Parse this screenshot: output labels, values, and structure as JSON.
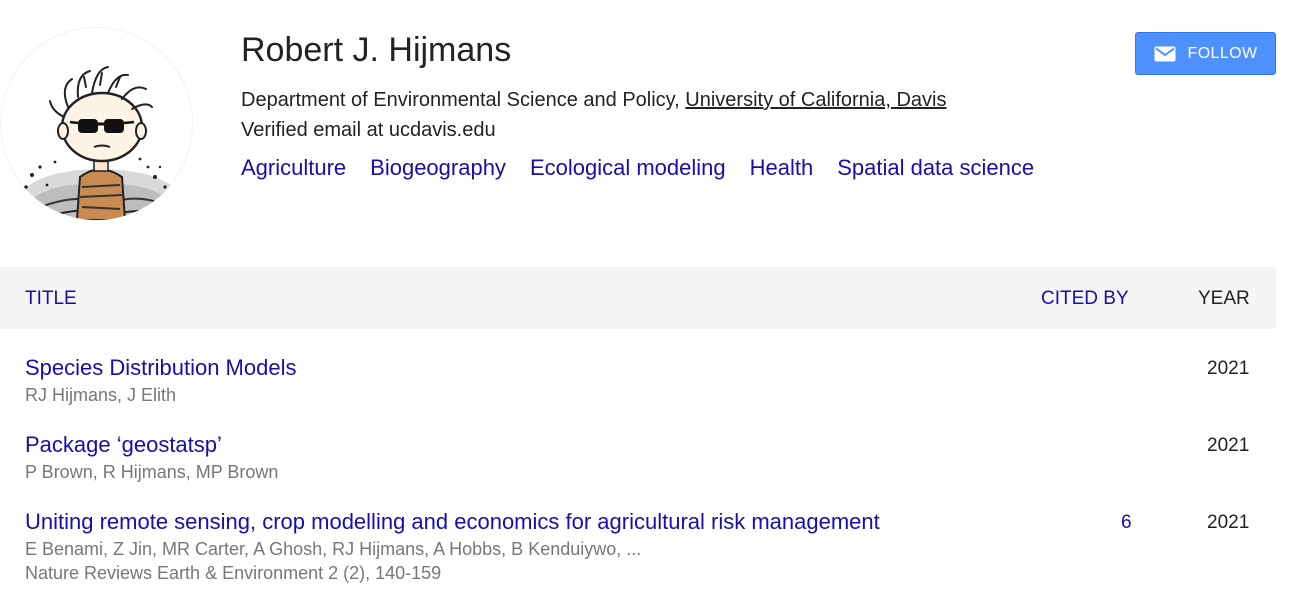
{
  "profile": {
    "name": "Robert J. Hijmans",
    "affiliation_prefix": "Department of Environmental Science and Policy, ",
    "affiliation_link": "University of California, Davis",
    "email": "Verified email at ucdavis.edu",
    "interests": [
      "Agriculture",
      "Biogeography",
      "Ecological modeling",
      "Health",
      "Spatial data science"
    ],
    "follow_label": "FOLLOW",
    "avatar_icon": "cartoon-character-with-sunglasses",
    "follow_icon": "envelope-icon"
  },
  "table": {
    "headers": {
      "title": "TITLE",
      "cited_by": "CITED BY",
      "year": "YEAR"
    },
    "rows": [
      {
        "title": "Species Distribution Models",
        "authors": "RJ Hijmans, J Elith",
        "venue": "",
        "cited_by": "",
        "year": "2021"
      },
      {
        "title": "Package ‘geostatsp’",
        "authors": "P Brown, R Hijmans, MP Brown",
        "venue": "",
        "cited_by": "",
        "year": "2021"
      },
      {
        "title": "Uniting remote sensing, crop modelling and economics for agricultural risk management",
        "authors": "E Benami, Z Jin, MR Carter, A Ghosh, RJ Hijmans, A Hobbs, B Kenduiywo, ...",
        "venue": "Nature Reviews Earth & Environment 2 (2), 140-159",
        "cited_by": "6",
        "year": "2021"
      }
    ]
  },
  "colors": {
    "link": "#1a0dab",
    "button": "#4d90fe",
    "header_bg": "#f5f5f5",
    "meta_text": "#777777"
  }
}
